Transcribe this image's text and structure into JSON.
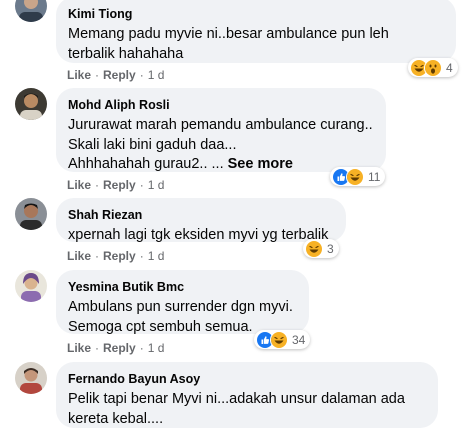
{
  "comments": [
    {
      "author": "Kimi Tiong",
      "text": "Memang padu myvie ni..besar ambulance pun leh\nterbalik hahahaha",
      "see_more": "",
      "like": "Like",
      "reply": "Reply",
      "time": "1 d",
      "reaction_icons": [
        "laugh-icon",
        "wow-icon"
      ],
      "reaction_count": "4"
    },
    {
      "author": "Mohd Aliph Rosli",
      "text": "Jururawat marah pemandu ambulance curang..\nSkali laki bini gaduh daa...\nAhhhahahah gurau2.. ... ",
      "see_more": "See more",
      "like": "Like",
      "reply": "Reply",
      "time": "1 d",
      "reaction_icons": [
        "like-icon",
        "laugh-icon"
      ],
      "reaction_count": "11"
    },
    {
      "author": "Shah Riezan",
      "text": "xpernah lagi tgk eksiden myvi yg terbalik",
      "see_more": "",
      "like": "Like",
      "reply": "Reply",
      "time": "1 d",
      "reaction_icons": [
        "laugh-icon"
      ],
      "reaction_count": "3"
    },
    {
      "author": "Yesmina Butik Bmc",
      "text": "Ambulans pun surrender dgn myvi.\nSemoga cpt sembuh semua.",
      "see_more": "",
      "like": "Like",
      "reply": "Reply",
      "time": "1 d",
      "reaction_icons": [
        "like-icon",
        "laugh-icon"
      ],
      "reaction_count": "34"
    },
    {
      "author": "Fernando Bayun Asoy",
      "text": "Pelik tapi benar Myvi ni...adakah unsur dalaman ada\nkereta kebal....",
      "see_more": "",
      "like": "",
      "reply": "",
      "time": "",
      "reaction_icons": [],
      "reaction_count": ""
    }
  ],
  "colors": {
    "bubble_bg": "#f0f2f5",
    "text": "#050505",
    "meta": "#65676b",
    "like_blue": "#1877f2",
    "emoji_yellow": "#f7b125"
  }
}
